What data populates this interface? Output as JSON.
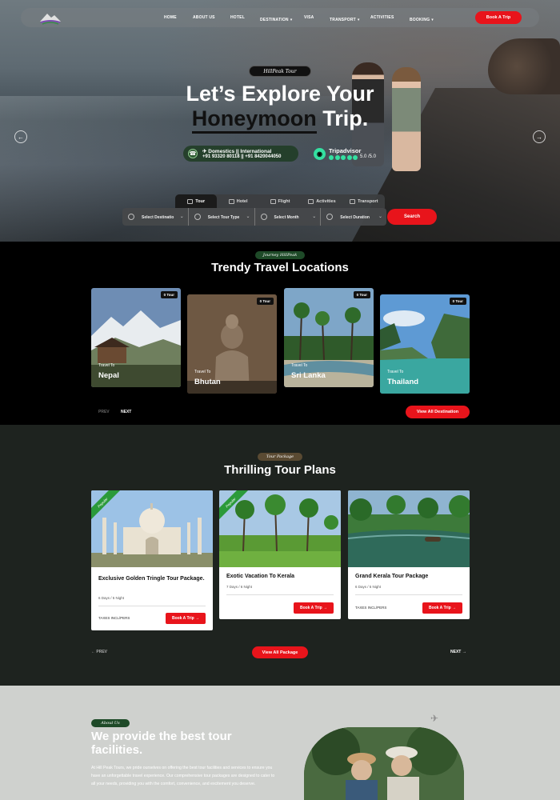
{
  "nav": {
    "links": [
      "HOME",
      "ABOUT US",
      "HOTEL",
      "DESTINATION",
      "VISA",
      "TRANSPORT",
      "ACTIVITIES",
      "BOOKING"
    ],
    "book_label": "Book A Trip"
  },
  "hero": {
    "badge": "HillPeak Tour",
    "title_line1": "Let’s Explore Your",
    "title_highlight": "Honeymoon",
    "title_tail": " Trip.",
    "contact_line1": "✈ Domestics || International",
    "contact_line2": "+91 93320 80118 || +91 8420044050",
    "tripadvisor": "Tripadvisor",
    "rating": "5.0 /5.0"
  },
  "search": {
    "tabs": [
      "Tour",
      "Hotel",
      "Flight",
      "Activities",
      "Transport"
    ],
    "fields": [
      "Select Destinatio",
      "Select Tour Type",
      "Select Month",
      "Select Duration"
    ],
    "button": "Search"
  },
  "destinations": {
    "badge": "Journey HillPeak",
    "title": "Trendy Travel Locations",
    "cards": [
      {
        "count": "0 Tour",
        "prefix": "Travel To",
        "name": "Nepal"
      },
      {
        "count": "0 Tour",
        "prefix": "Travel To",
        "name": "Bhutan"
      },
      {
        "count": "0 Tour",
        "prefix": "Travel To",
        "name": "Sri Lanka"
      },
      {
        "count": "0 Tour",
        "prefix": "Travel To",
        "name": "Thailand"
      }
    ],
    "prev": "PREV",
    "next": "NEXT",
    "view_all": "View All Destination"
  },
  "packages": {
    "badge": "Tour Package",
    "title": "Thrilling Tour Plans",
    "cards": [
      {
        "ribbon": "Popular",
        "title": "Exclusive Golden Tringle Tour Package.",
        "duration": "6 Days / 5 Night",
        "tax": "TAXES INCL/PERS",
        "button": "Book A Trip"
      },
      {
        "ribbon": "Popular",
        "title": "Exotic Vacation To Kerala",
        "duration": "7 Days / 6 Night",
        "tax": "",
        "button": "Book A Trip"
      },
      {
        "ribbon": "",
        "title": "Grand Kerala Tour Package",
        "duration": "6 Days / 5 Night",
        "tax": "TAXES INCL/PERS",
        "button": "Book A Trip"
      }
    ],
    "prev": "PREV",
    "next": "NEXT",
    "view_all": "View All Package"
  },
  "about": {
    "badge": "About Us",
    "heading": "We provide the best tour facilities.",
    "paragraph": "At Hill Peak Tours, we pride ourselves on offering the best tour facilities and services to ensure you have an unforgettable travel experience. Our comprehensive tour packages are designed to cater to all your needs, providing you with the comfort, convenience, and excitement you deserve."
  },
  "colors": {
    "accent": "#e8141b",
    "green": "#2b9a3a",
    "dark": "#1e231f"
  }
}
